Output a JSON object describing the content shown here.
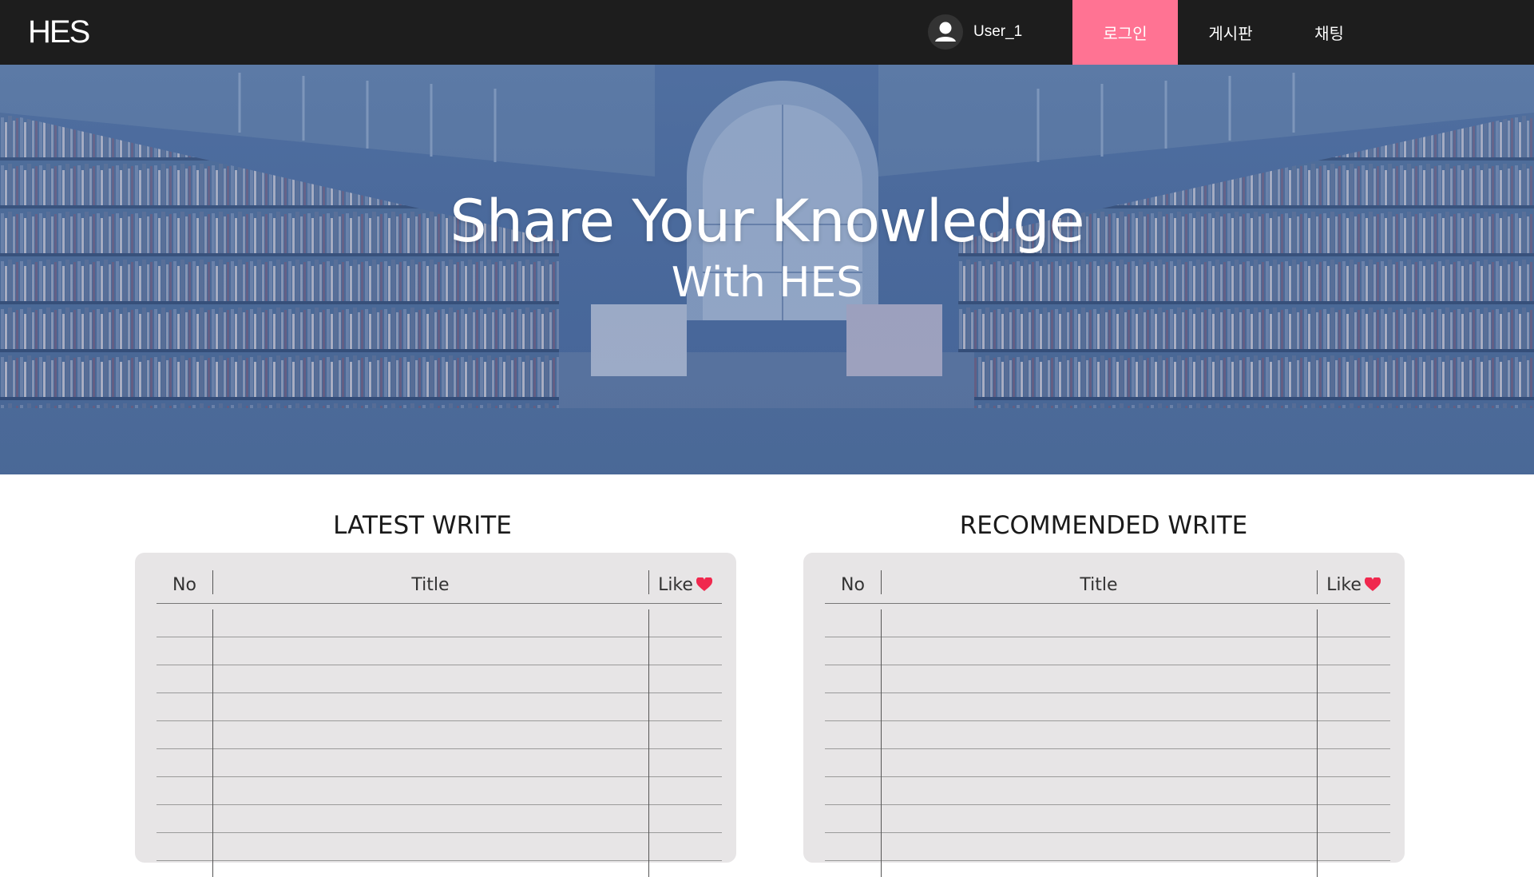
{
  "nav": {
    "logo": "HES",
    "user_name": "User_1",
    "login_label": "로그인",
    "board_label": "게시판",
    "chat_label": "채팅",
    "active_color": "#ff7393"
  },
  "hero": {
    "title": "Share Your Knowledge",
    "subtitle": "With HES"
  },
  "latest": {
    "title": "LATEST WRITE",
    "columns": {
      "no": "No",
      "title": "Title",
      "like": "Like"
    }
  },
  "recommended": {
    "title": "RECOMMENDED WRITE",
    "columns": {
      "no": "No",
      "title": "Title",
      "like": "Like"
    }
  },
  "accent_heart_color": "#f0284e"
}
